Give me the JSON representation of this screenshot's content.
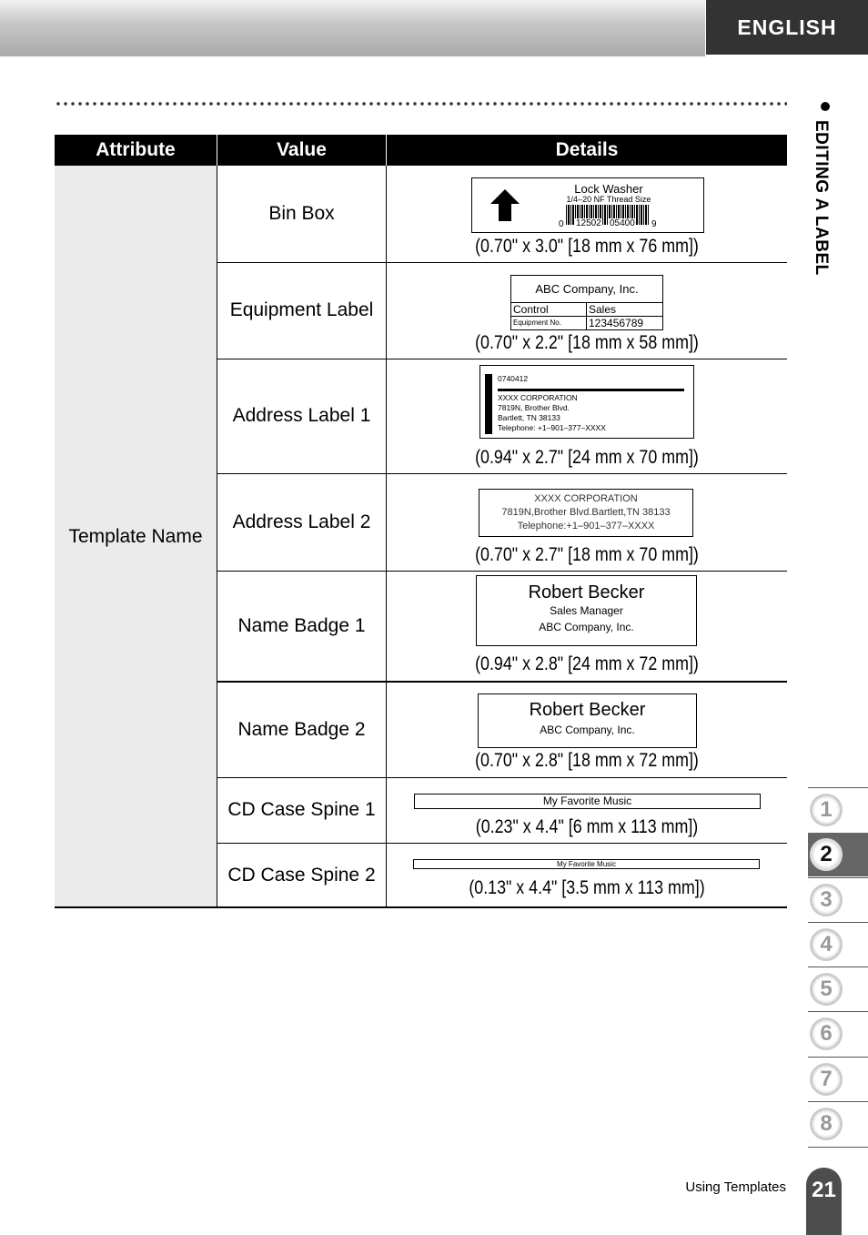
{
  "header": {
    "language": "ENGLISH",
    "section": "EDITING A LABEL"
  },
  "table": {
    "columns": [
      "Attribute",
      "Value",
      "Details"
    ],
    "attribute": "Template Name",
    "rows": [
      {
        "value": "Bin Box",
        "size": "(0.70\" x 3.0\" [18 mm x 76 mm])",
        "label": {
          "title": "Lock Washer",
          "subtitle": "1/4–20 NF Thread Size",
          "barcode_left": "0",
          "barcode_mid1": "12502",
          "barcode_mid2": "05400",
          "barcode_right": "9"
        }
      },
      {
        "value": "Equipment Label",
        "size": "(0.70\" x 2.2\" [18 mm x 58 mm])",
        "label": {
          "company": "ABC Company, Inc.",
          "c1": "Control",
          "c2": "Sales",
          "c3": "Equipment No.",
          "c4": "123456789"
        }
      },
      {
        "value": "Address Label 1",
        "size": "(0.94\" x 2.7\" [24 mm x 70 mm])",
        "label": {
          "code": "0740412",
          "l1": "XXXX CORPORATION",
          "l2": "7819N, Brother Blvd.",
          "l3": "Bartlett, TN 38133",
          "l4": "Telephone: +1–901–377–XXXX"
        }
      },
      {
        "value": "Address Label 2",
        "size": "(0.70\" x 2.7\" [18 mm x 70 mm])",
        "label": {
          "l1": "XXXX CORPORATION",
          "l2": "7819N,Brother Blvd.Bartlett,TN 38133",
          "l3": "Telephone:+1–901–377–XXXX"
        }
      },
      {
        "value": "Name Badge 1",
        "size": "(0.94\" x 2.8\" [24 mm x 72 mm])",
        "label": {
          "name": "Robert Becker",
          "title": "Sales Manager",
          "company": "ABC Company, Inc."
        }
      },
      {
        "value": "Name Badge 2",
        "size": "(0.70\" x 2.8\" [18 mm x 72 mm])",
        "label": {
          "name": "Robert Becker",
          "company": "ABC Company, Inc."
        }
      },
      {
        "value": "CD Case Spine 1",
        "size": "(0.23\" x 4.4\" [6 mm x 113 mm])",
        "label": {
          "text": "My Favorite Music"
        }
      },
      {
        "value": "CD Case Spine 2",
        "size": "(0.13\" x 4.4\" [3.5 mm x 113 mm])",
        "label": {
          "text": "My Favorite Music"
        }
      }
    ]
  },
  "chapters": {
    "items": [
      "1",
      "2",
      "3",
      "4",
      "5",
      "6",
      "7",
      "8"
    ],
    "active": "2"
  },
  "footer": {
    "title": "Using Templates",
    "page": "21"
  }
}
